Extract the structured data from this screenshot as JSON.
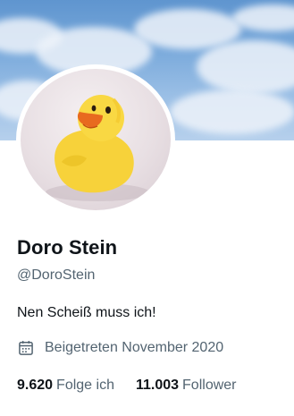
{
  "profile": {
    "display_name": "Doro Stein",
    "handle": "@DoroStein",
    "bio": "Nen Scheiß muss ich!",
    "joined": "Beigetreten November 2020",
    "following_count": "9.620",
    "following_label": "Folge ich",
    "followers_count": "11.003",
    "followers_label": "Follower"
  },
  "icons": {
    "joined": "calendar-icon",
    "avatar": "rubber-duck-image",
    "banner": "sky-clouds-image"
  },
  "colors": {
    "text_primary": "#0f1419",
    "text_secondary": "#536471",
    "duck_yellow": "#f7d23a",
    "beak_orange": "#e86a1f"
  }
}
